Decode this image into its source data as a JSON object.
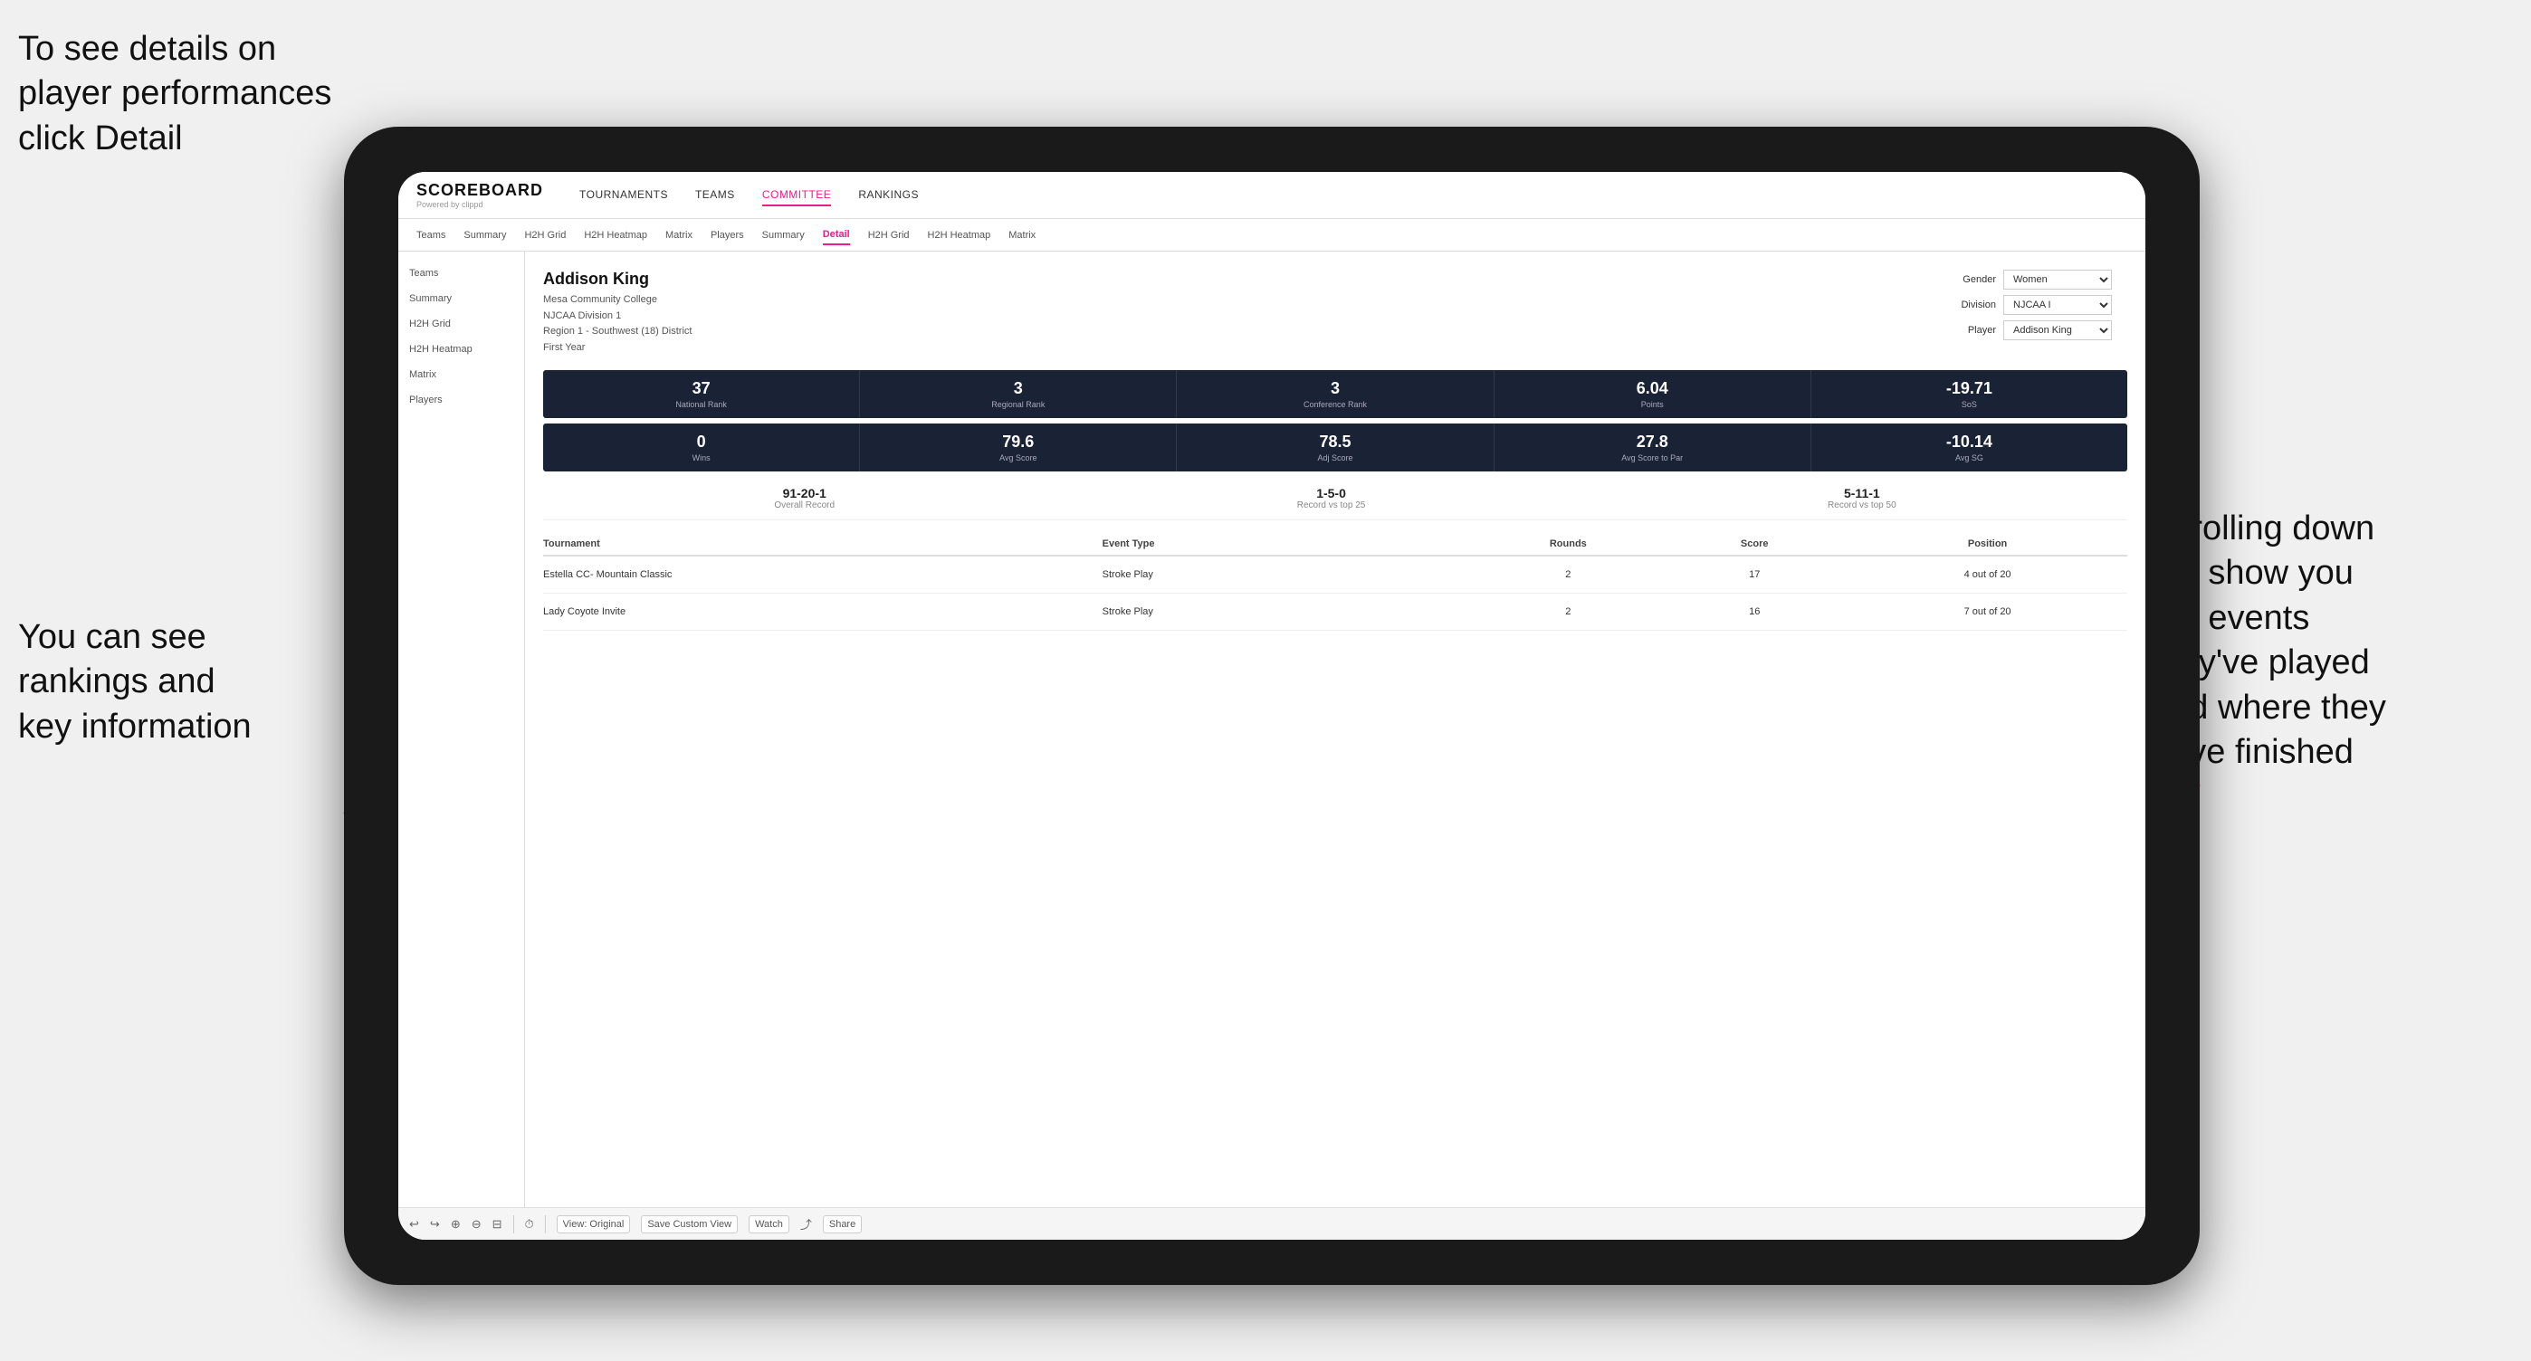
{
  "annotations": {
    "top_left": "To see details on player performances click Detail",
    "top_left_bold": "Detail",
    "bottom_left_line1": "You can see",
    "bottom_left_line2": "rankings and",
    "bottom_left_line3": "key information",
    "right_line1": "Scrolling down",
    "right_line2": "will show you",
    "right_line3": "the events",
    "right_line4": "they've played",
    "right_line5": "and where they",
    "right_line6": "have finished"
  },
  "nav": {
    "logo": "SCOREBOARD",
    "logo_sub": "Powered by clippd",
    "items": [
      {
        "label": "TOURNAMENTS",
        "active": false
      },
      {
        "label": "TEAMS",
        "active": false
      },
      {
        "label": "COMMITTEE",
        "active": true
      },
      {
        "label": "RANKINGS",
        "active": false
      }
    ]
  },
  "sub_nav": {
    "items": [
      {
        "label": "Teams",
        "active": false
      },
      {
        "label": "Summary",
        "active": false
      },
      {
        "label": "H2H Grid",
        "active": false
      },
      {
        "label": "H2H Heatmap",
        "active": false
      },
      {
        "label": "Matrix",
        "active": false
      },
      {
        "label": "Players",
        "active": false
      },
      {
        "label": "Summary",
        "active": false
      },
      {
        "label": "Detail",
        "active": true
      },
      {
        "label": "H2H Grid",
        "active": false
      },
      {
        "label": "H2H Heatmap",
        "active": false
      },
      {
        "label": "Matrix",
        "active": false
      }
    ]
  },
  "player": {
    "name": "Addison King",
    "school": "Mesa Community College",
    "division": "NJCAA Division 1",
    "region": "Region 1 - Southwest (18) District",
    "year": "First Year"
  },
  "filters": {
    "gender_label": "Gender",
    "gender_value": "Women",
    "division_label": "Division",
    "division_value": "NJCAA I",
    "player_label": "Player",
    "player_value": "Addison King"
  },
  "stats_row1": [
    {
      "value": "37",
      "label": "National Rank"
    },
    {
      "value": "3",
      "label": "Regional Rank"
    },
    {
      "value": "3",
      "label": "Conference Rank"
    },
    {
      "value": "6.04",
      "label": "Points"
    },
    {
      "value": "-19.71",
      "label": "SoS"
    }
  ],
  "stats_row2": [
    {
      "value": "0",
      "label": "Wins"
    },
    {
      "value": "79.6",
      "label": "Avg Score"
    },
    {
      "value": "78.5",
      "label": "Adj Score"
    },
    {
      "value": "27.8",
      "label": "Avg Score to Par"
    },
    {
      "value": "-10.14",
      "label": "Avg SG"
    }
  ],
  "records": [
    {
      "value": "91-20-1",
      "label": "Overall Record"
    },
    {
      "value": "1-5-0",
      "label": "Record vs top 25"
    },
    {
      "value": "5-11-1",
      "label": "Record vs top 50"
    }
  ],
  "table": {
    "headers": [
      "Tournament",
      "Event Type",
      "Rounds",
      "Score",
      "Position"
    ],
    "rows": [
      {
        "tournament": "Estella CC- Mountain Classic",
        "event_type": "Stroke Play",
        "rounds": "2",
        "score": "17",
        "position": "4 out of 20"
      },
      {
        "tournament": "Lady Coyote Invite",
        "event_type": "Stroke Play",
        "rounds": "2",
        "score": "16",
        "position": "7 out of 20"
      }
    ]
  },
  "toolbar": {
    "view_original": "View: Original",
    "save_custom": "Save Custom View",
    "watch": "Watch",
    "share": "Share"
  }
}
